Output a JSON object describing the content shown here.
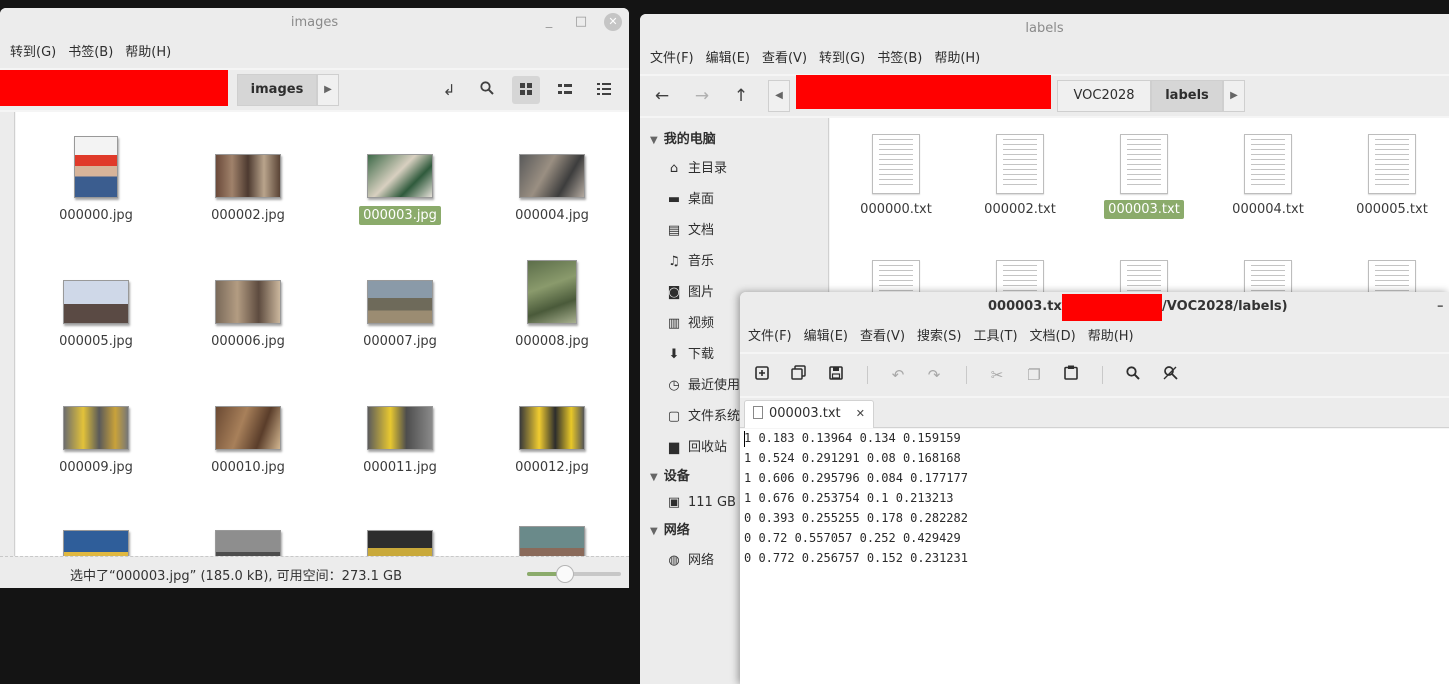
{
  "images_window": {
    "title": "images",
    "menu": [
      "转到(G)",
      "书签(B)",
      "帮助(H)"
    ],
    "breadcrumb_current": "images",
    "files": [
      {
        "name": "000000.jpg",
        "selected": false
      },
      {
        "name": "000002.jpg",
        "selected": false
      },
      {
        "name": "000003.jpg",
        "selected": true
      },
      {
        "name": "000004.jpg",
        "selected": false
      },
      {
        "name": "000005.jpg",
        "selected": false
      },
      {
        "name": "000006.jpg",
        "selected": false
      },
      {
        "name": "000007.jpg",
        "selected": false
      },
      {
        "name": "000008.jpg",
        "selected": false
      },
      {
        "name": "000009.jpg",
        "selected": false
      },
      {
        "name": "000010.jpg",
        "selected": false
      },
      {
        "name": "000011.jpg",
        "selected": false
      },
      {
        "name": "000012.jpg",
        "selected": false
      }
    ],
    "status": "选中了“000003.jpg” (185.0 kB), 可用空间：273.1 GB",
    "zoom_fraction": 0.4
  },
  "labels_window": {
    "title": "labels",
    "menu": [
      "文件(F)",
      "编辑(E)",
      "查看(V)",
      "转到(G)",
      "书签(B)",
      "帮助(H)"
    ],
    "breadcrumbs": [
      "VOC2028",
      "labels"
    ],
    "sidebar": {
      "my_computer": "我的电脑",
      "places": [
        {
          "label": "主目录",
          "icon": "home-icon"
        },
        {
          "label": "桌面",
          "icon": "desktop-icon"
        },
        {
          "label": "文档",
          "icon": "document-icon"
        },
        {
          "label": "音乐",
          "icon": "music-icon"
        },
        {
          "label": "图片",
          "icon": "camera-icon"
        },
        {
          "label": "视频",
          "icon": "film-icon"
        },
        {
          "label": "下载",
          "icon": "download-icon"
        },
        {
          "label": "最近使用",
          "icon": "recent-icon"
        },
        {
          "label": "文件系统",
          "icon": "drive-icon"
        },
        {
          "label": "回收站",
          "icon": "trash-icon"
        }
      ],
      "devices_head": "设备",
      "devices": [
        {
          "label": "111 GB",
          "icon": "disk-icon"
        }
      ],
      "network_head": "网络",
      "network": [
        {
          "label": "网络",
          "icon": "globe-icon"
        }
      ]
    },
    "files": [
      {
        "name": "000000.txt",
        "selected": false
      },
      {
        "name": "000002.txt",
        "selected": false
      },
      {
        "name": "000003.txt",
        "selected": true
      },
      {
        "name": "000004.txt",
        "selected": false
      },
      {
        "name": "000005.txt",
        "selected": false
      }
    ]
  },
  "editor_window": {
    "title_left": "000003.txt",
    "title_right": "/VOC2028/labels)",
    "menu": [
      "文件(F)",
      "编辑(E)",
      "查看(V)",
      "搜索(S)",
      "工具(T)",
      "文档(D)",
      "帮助(H)"
    ],
    "tab_label": "000003.txt",
    "tab_close": "✕",
    "lines": [
      "1 0.183 0.13964 0.134 0.159159",
      "1 0.524 0.291291 0.08 0.168168",
      "1 0.606 0.295796 0.084 0.177177",
      "1 0.676 0.253754 0.1 0.213213",
      "0 0.393 0.255255 0.178 0.282282",
      "0 0.72 0.557057 0.252 0.429429",
      "0 0.772 0.256757 0.152 0.231231"
    ]
  },
  "colors": {
    "selection": "#8bab6b",
    "redaction": "#ff0000"
  }
}
